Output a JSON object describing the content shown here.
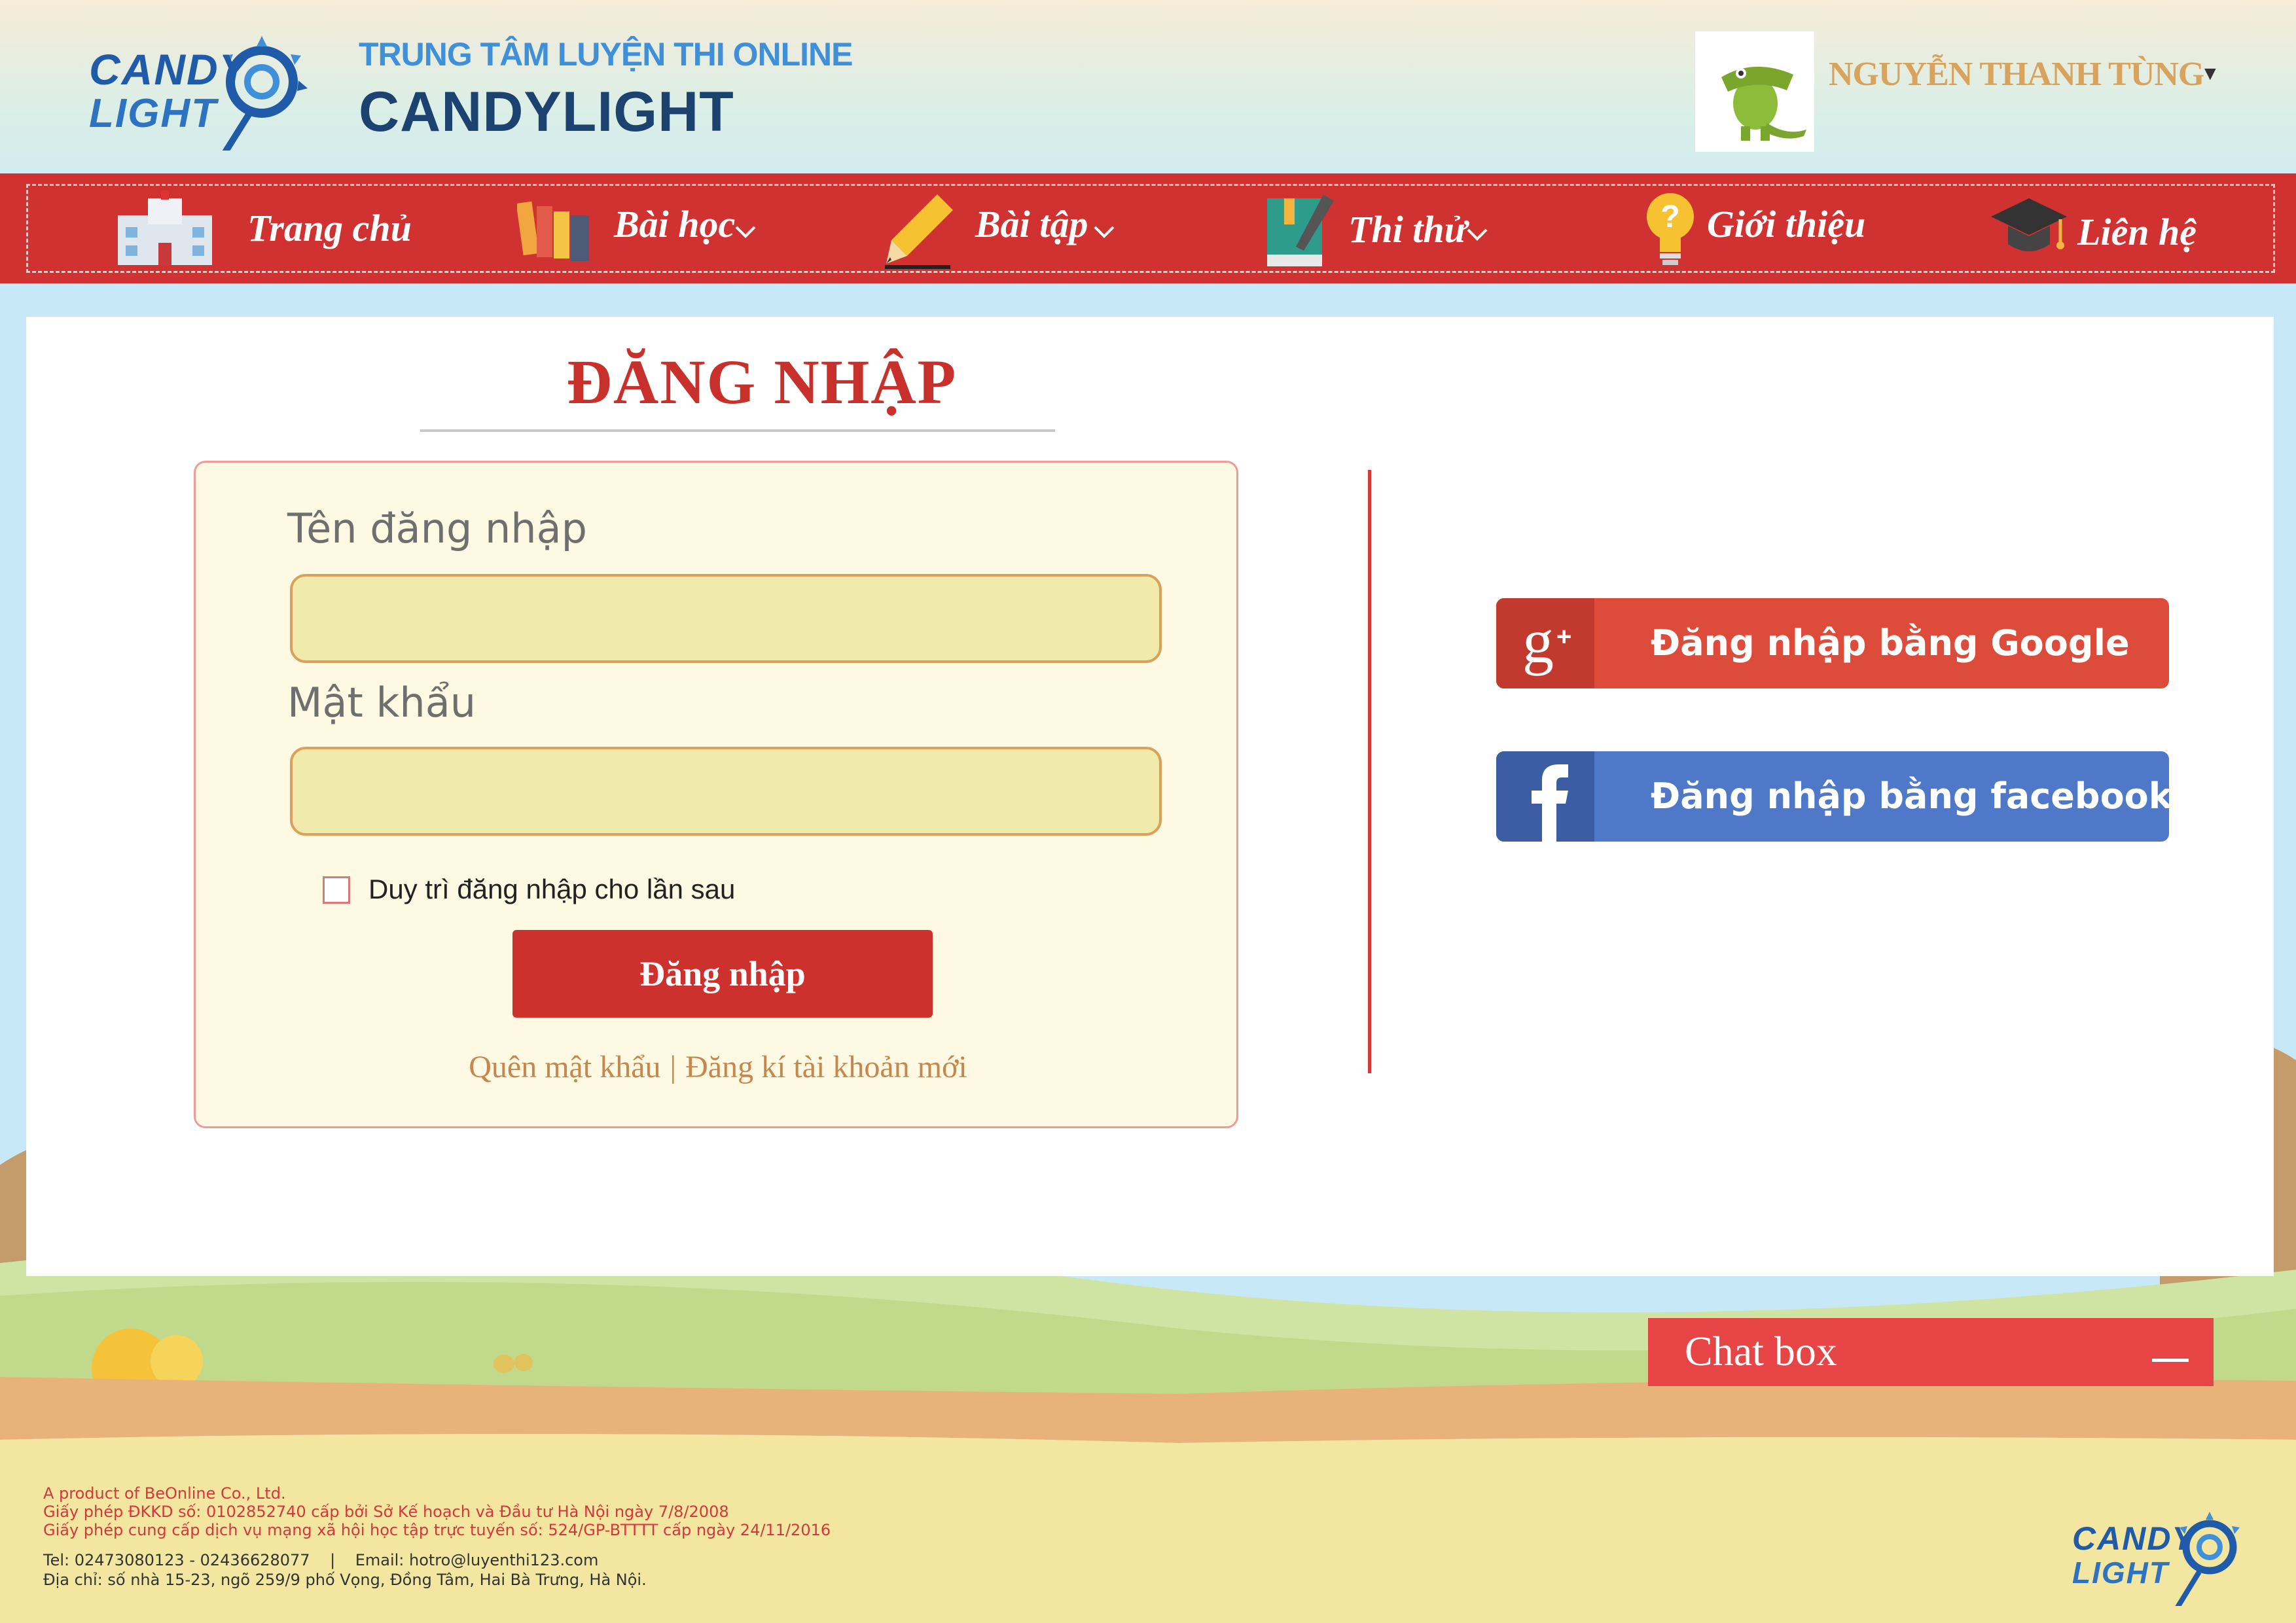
{
  "header": {
    "logo_top": "CANDY",
    "logo_bottom": "LIGHT",
    "site_subtitle": "TRUNG TÂM LUYỆN THI ONLINE",
    "site_name": "CANDYLIGHT",
    "user_name": "NGUYỄN THANH TÙNG",
    "user_caret": "▼"
  },
  "nav": {
    "items": [
      {
        "label": "Trang chủ",
        "icon": "school-icon"
      },
      {
        "label": "Bài học",
        "icon": "books-icon"
      },
      {
        "label": "Bài tập",
        "icon": "pencil-icon"
      },
      {
        "label": "Thi thử",
        "icon": "notebook-icon"
      },
      {
        "label": "Giới thiệu",
        "icon": "lightbulb-question-icon"
      },
      {
        "label": "Liên hệ",
        "icon": "graduation-cap-icon"
      }
    ]
  },
  "login": {
    "title": "ĐĂNG NHẬP",
    "username_label": "Tên đăng nhập",
    "username_value": "",
    "password_label": "Mật khẩu",
    "password_value": "",
    "remember_label": "Duy trì đăng nhập cho lần sau",
    "submit_label": "Đăng nhập",
    "forgot_label": "Quên mật khẩu",
    "separator": "|",
    "register_label": "Đăng kí tài khoản mới"
  },
  "social": {
    "google_label": "Đăng nhập bằng Google",
    "facebook_label": "Đăng nhập bằng facebook"
  },
  "chat": {
    "title": "Chat box"
  },
  "footer": {
    "line1": "A product of BeOnline Co., Ltd.",
    "line2": "Giấy phép ĐKKD số: 0102852740 cấp bởi Sở Kế hoạch và Đầu tư Hà Nội ngày 7/8/2008",
    "line3": "Giấy phép cung cấp dịch vụ mạng xã hội học tập trực tuyến số: 524/GP-BTTTT cấp ngày 24/11/2016",
    "line4": "Tel: 02473080123 - 02436628077    |    Email: hotro@luyenthi123.com",
    "line5": "Địa chỉ: số nhà 15-23, ngõ 259/9 phố Vọng, Đồng Tâm, Hai Bà Trưng, Hà Nội."
  },
  "colors": {
    "nav_red": "#cf3230",
    "title_red": "#c8302c",
    "google": "#dd4c3a",
    "facebook": "#4f78c8",
    "chat": "#e74446"
  }
}
